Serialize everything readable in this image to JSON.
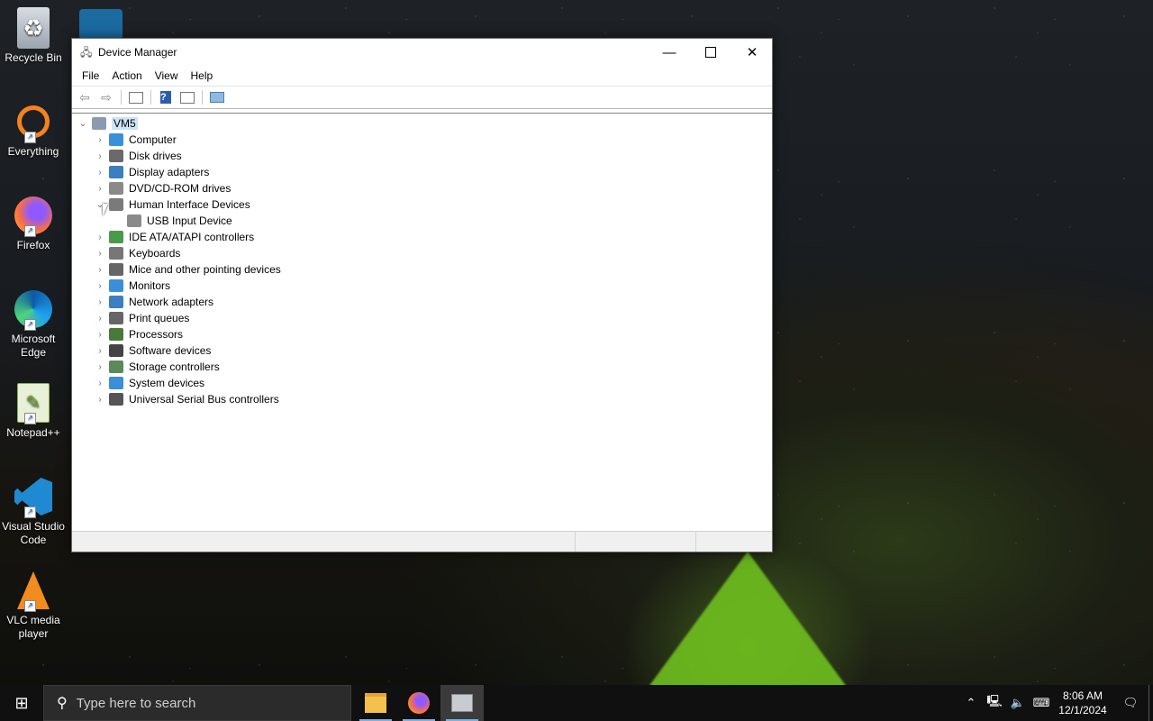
{
  "desktop": {
    "icons": [
      {
        "label": "Recycle Bin",
        "icon": "recycle-bin-icon"
      },
      {
        "label": "Everything",
        "icon": "search-magnifier-icon"
      },
      {
        "label": "Firefox",
        "icon": "firefox-icon"
      },
      {
        "label": "Microsoft Edge",
        "icon": "edge-icon"
      },
      {
        "label": "Notepad++",
        "icon": "notepad-plus-plus-icon"
      },
      {
        "label": "Visual Studio Code",
        "icon": "vscode-icon"
      },
      {
        "label": "VLC media player",
        "icon": "vlc-cone-icon"
      }
    ]
  },
  "window": {
    "title": "Device Manager",
    "menu": [
      "File",
      "Action",
      "View",
      "Help"
    ],
    "toolbar": [
      "back-icon",
      "forward-icon",
      "properties-icon",
      "help-icon",
      "update-driver-icon",
      "scan-hardware-icon"
    ],
    "tree": {
      "root": "VM5",
      "categories": [
        {
          "label": "Computer",
          "color": "#3a8fd8",
          "expanded": false
        },
        {
          "label": "Disk drives",
          "color": "#6a6a6a",
          "expanded": false
        },
        {
          "label": "Display adapters",
          "color": "#3a7fc0",
          "expanded": false
        },
        {
          "label": "DVD/CD-ROM drives",
          "color": "#8a8a8a",
          "expanded": false
        },
        {
          "label": "Human Interface Devices",
          "color": "#7a7a7a",
          "expanded": true,
          "children": [
            "USB Input Device"
          ]
        },
        {
          "label": "IDE ATA/ATAPI controllers",
          "color": "#4a9a4a",
          "expanded": false
        },
        {
          "label": "Keyboards",
          "color": "#777777",
          "expanded": false
        },
        {
          "label": "Mice and other pointing devices",
          "color": "#666666",
          "expanded": false
        },
        {
          "label": "Monitors",
          "color": "#3a8fd8",
          "expanded": false
        },
        {
          "label": "Network adapters",
          "color": "#3a7fc0",
          "expanded": false
        },
        {
          "label": "Print queues",
          "color": "#666666",
          "expanded": false
        },
        {
          "label": "Processors",
          "color": "#4a7a3a",
          "expanded": false
        },
        {
          "label": "Software devices",
          "color": "#444444",
          "expanded": false
        },
        {
          "label": "Storage controllers",
          "color": "#5a8a5a",
          "expanded": false
        },
        {
          "label": "System devices",
          "color": "#3a8fd8",
          "expanded": false
        },
        {
          "label": "Universal Serial Bus controllers",
          "color": "#555555",
          "expanded": false
        }
      ]
    }
  },
  "taskbar": {
    "search_placeholder": "Type here to search",
    "apps": [
      "file-explorer-icon",
      "firefox-icon",
      "device-manager-icon"
    ],
    "clock_time": "8:06 AM",
    "clock_date": "12/1/2024"
  }
}
